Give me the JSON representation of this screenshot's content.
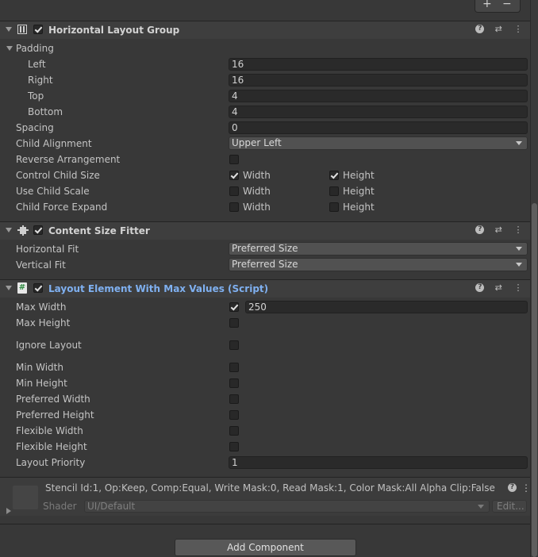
{
  "top_buttons": {
    "add": "+",
    "remove": "−"
  },
  "horizontal_layout_group": {
    "title": "Horizontal Layout Group",
    "padding_label": "Padding",
    "left": {
      "label": "Left",
      "value": "16"
    },
    "right": {
      "label": "Right",
      "value": "16"
    },
    "top": {
      "label": "Top",
      "value": "4"
    },
    "bottom": {
      "label": "Bottom",
      "value": "4"
    },
    "spacing": {
      "label": "Spacing",
      "value": "0"
    },
    "child_alignment": {
      "label": "Child Alignment",
      "value": "Upper Left"
    },
    "reverse_arrangement": {
      "label": "Reverse Arrangement"
    },
    "control_child_size": {
      "label": "Control Child Size",
      "width": "Width",
      "height": "Height"
    },
    "use_child_scale": {
      "label": "Use Child Scale",
      "width": "Width",
      "height": "Height"
    },
    "child_force_expand": {
      "label": "Child Force Expand",
      "width": "Width",
      "height": "Height"
    }
  },
  "content_size_fitter": {
    "title": "Content Size Fitter",
    "horizontal_fit": {
      "label": "Horizontal Fit",
      "value": "Preferred Size"
    },
    "vertical_fit": {
      "label": "Vertical Fit",
      "value": "Preferred Size"
    }
  },
  "layout_element": {
    "title": "Layout Element With Max Values (Script)",
    "max_width": {
      "label": "Max Width",
      "value": "250"
    },
    "max_height": {
      "label": "Max Height"
    },
    "ignore_layout": {
      "label": "Ignore Layout"
    },
    "min_width": {
      "label": "Min Width"
    },
    "min_height": {
      "label": "Min Height"
    },
    "preferred_width": {
      "label": "Preferred Width"
    },
    "preferred_height": {
      "label": "Preferred Height"
    },
    "flexible_width": {
      "label": "Flexible Width"
    },
    "flexible_height": {
      "label": "Flexible Height"
    },
    "layout_priority": {
      "label": "Layout Priority",
      "value": "1"
    }
  },
  "material": {
    "info": "Stencil Id:1, Op:Keep, Comp:Equal, Write Mask:0, Read Mask:1, Color Mask:All Alpha Clip:False",
    "shader_label": "Shader",
    "shader_value": "UI/Default",
    "edit_label": "Edit..."
  },
  "add_component": "Add Component",
  "colors": {
    "accent_link": "#7fb0f0",
    "background": "#383838",
    "header": "#3e3e3e"
  }
}
